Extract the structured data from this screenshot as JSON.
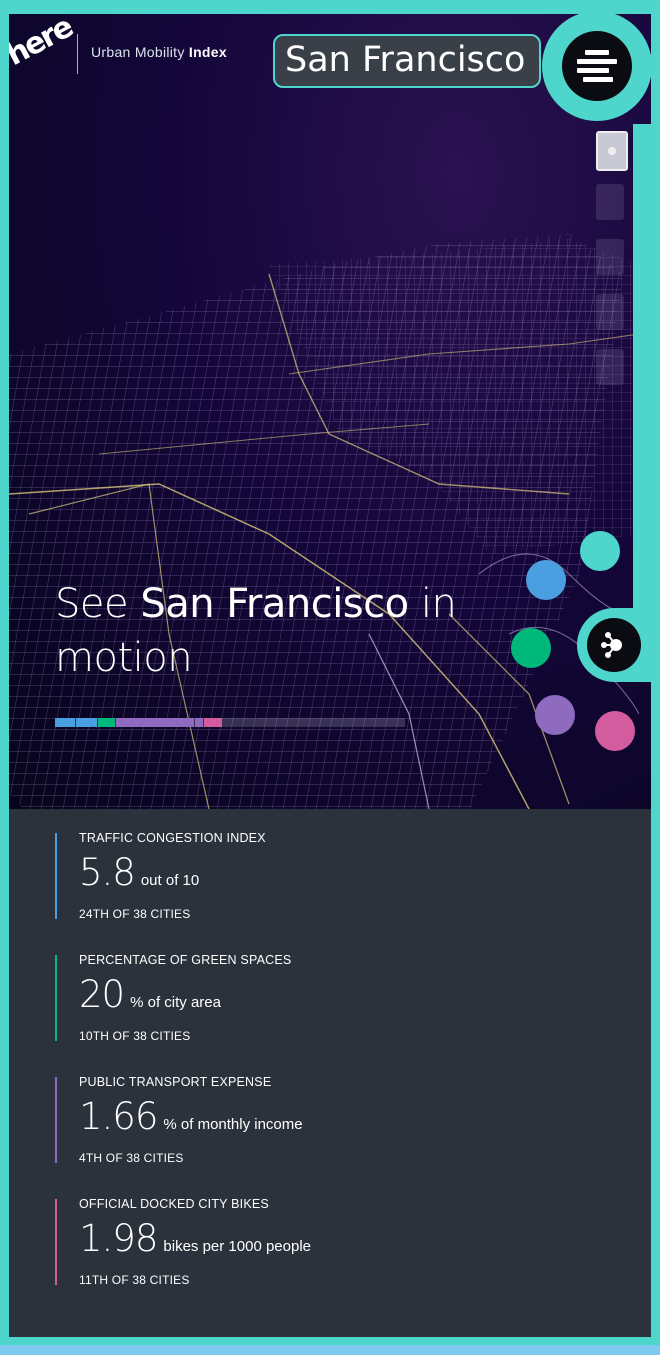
{
  "header": {
    "logo_text": "here",
    "app_name_prefix": "Urban Mobility",
    "app_name_bold": "Index",
    "city": "San Francisco"
  },
  "icons": {
    "menu": "menu-icon",
    "share": "share-network-icon"
  },
  "hero": {
    "headline_prefix": "See",
    "headline_city": "San Francisco",
    "headline_suffix": "in motion"
  },
  "colors": {
    "accent": "#4fd6cc",
    "congestion": "#4a9fe0",
    "green": "#00b87a",
    "transport": "#8e6bbf",
    "bikes": "#d35c9e",
    "panel": "#2b323b"
  },
  "category_dots": [
    {
      "name": "congestion",
      "color": "#4a9fe0"
    },
    {
      "name": "teal",
      "color": "#4fd6cc"
    },
    {
      "name": "green-spaces",
      "color": "#00b87a"
    },
    {
      "name": "public-transport",
      "color": "#8e6bbf"
    },
    {
      "name": "bikes",
      "color": "#d35c9e"
    }
  ],
  "stats": [
    {
      "label": "TRAFFIC CONGESTION INDEX",
      "value": "5.8",
      "unit": "out of 10",
      "rank": "24TH OF 38 CITIES",
      "color": "#4a9fe0"
    },
    {
      "label": "PERCENTAGE OF GREEN SPACES",
      "value": "20",
      "unit": "% of city area",
      "rank": "10TH OF 38 CITIES",
      "color": "#00b87a"
    },
    {
      "label": "PUBLIC TRANSPORT EXPENSE",
      "value": "1.66",
      "unit": "% of monthly income",
      "rank": "4TH OF 38 CITIES",
      "color": "#8e6bbf"
    },
    {
      "label": "OFFICIAL DOCKED CITY BIKES",
      "value": "1.98",
      "unit": "bikes per 1000 people",
      "rank": "11TH OF 38 CITIES",
      "color": "#d35c9e"
    }
  ]
}
